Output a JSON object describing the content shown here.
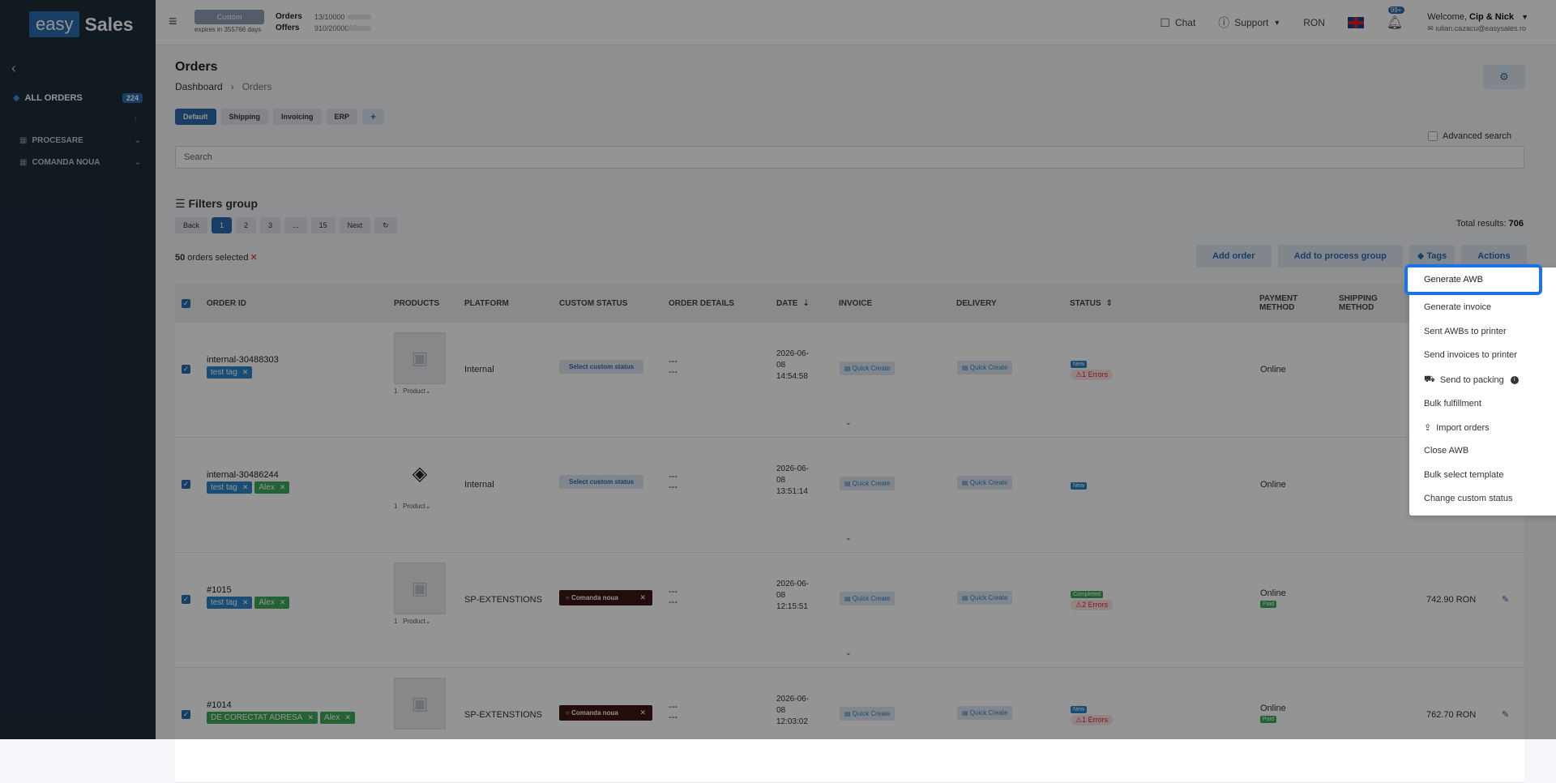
{
  "sidebar": {
    "logo_easy": "easy",
    "logo_sales": "Sales",
    "all_orders": "ALL ORDERS",
    "all_orders_count": "224",
    "groups": [
      "PROCESARE",
      "COMANDA NOUA"
    ]
  },
  "topbar": {
    "plan": "Custom",
    "expires": "expires in 355766 days",
    "orders_label": "Orders",
    "orders_value": "13/10000",
    "offers_label": "Offers",
    "offers_value": "910/2000000",
    "chat": "Chat",
    "support": "Support",
    "currency": "RON",
    "notif_badge": "99+",
    "welcome_prefix": "Welcome, ",
    "user_name": "Cip & Nick",
    "email": "iulian.cazacu@easysales.ro"
  },
  "page": {
    "title": "Orders",
    "breadcrumb_home": "Dashboard",
    "breadcrumb_current": "Orders",
    "view_tabs": [
      "Default",
      "Shipping",
      "Invoicing",
      "ERP"
    ],
    "advanced_search": "Advanced search",
    "search_placeholder": "Search",
    "filters_title": "Filters group",
    "pager": [
      "Back",
      "1",
      "2",
      "3",
      "...",
      "15",
      "Next"
    ],
    "total_label": "Total results: ",
    "total_value": "706",
    "selected_count": "50",
    "selected_text": " orders selected",
    "bulk_buttons": [
      "Add order",
      "Add to process group",
      "Tags",
      "Actions"
    ]
  },
  "table": {
    "headers": {
      "order_id": "ORDER ID",
      "products": "PRODUCTS",
      "platform": "PLATFORM",
      "custom_status": "CUSTOM STATUS",
      "order_details": "ORDER DETAILS",
      "date": "DATE",
      "invoice": "INVOICE",
      "delivery": "DELIVERY",
      "status": "STATUS",
      "payment_method_1": "PAYMENT",
      "payment_method_2": "METHOD",
      "shipping_method_1": "SHIPPING",
      "shipping_method_2": "METHOD"
    },
    "quick_create": "Quick Create",
    "product_label": "Product",
    "select_custom_status": "Select custom status",
    "rows": [
      {
        "id": "internal-30488303",
        "tags": [
          "test tag"
        ],
        "green_tags": [],
        "qty": "1",
        "platform": "Internal",
        "custom": "",
        "d1": "2026-06-",
        "d2": "08",
        "d3": "14:54:58",
        "status": "New",
        "errors": "1 Errors",
        "payment": "Online",
        "paid": "",
        "total": ""
      },
      {
        "id": "internal-30486244",
        "tags": [
          "test tag"
        ],
        "green_tags": [
          "Alex"
        ],
        "qty": "1",
        "platform": "Internal",
        "custom": "",
        "d1": "2026-06-",
        "d2": "08",
        "d3": "13:51:14",
        "status": "New",
        "errors": "",
        "payment": "Online",
        "paid": "",
        "total": ""
      },
      {
        "id": "#1015",
        "tags": [
          "test tag"
        ],
        "green_tags": [
          "Alex"
        ],
        "qty": "1",
        "platform": "SP-EXTENSTIONS",
        "custom": "Comanda noua",
        "d1": "2026-06-",
        "d2": "08",
        "d3": "12:15:51",
        "status": "Completed",
        "errors": "2 Errors",
        "payment": "Online",
        "paid": "Paid",
        "total": "742.90 RON"
      },
      {
        "id": "#1014",
        "tags": [],
        "green_tags": [
          "DE CORECTAT ADRESA",
          "Alex"
        ],
        "qty": "1",
        "platform": "SP-EXTENSTIONS",
        "custom": "Comanda noua",
        "d1": "2026-06-",
        "d2": "08",
        "d3": "12:03:02",
        "status": "New",
        "errors": "1 Errors",
        "payment": "Online",
        "paid": "Paid",
        "total": "762.70 RON"
      }
    ],
    "dashes": "---"
  },
  "actions_menu": {
    "items": [
      "Generate AWB",
      "Generate invoice",
      "Sent AWBs to printer",
      "Send invoices to printer",
      "Send to packing",
      "Bulk fulfillment",
      "Import orders",
      "Close AWB",
      "Bulk select template",
      "Change custom status"
    ],
    "highlighted": "Generate AWB"
  },
  "colors": {
    "primary": "#2b6cb0",
    "sidebar": "#1e2b3a",
    "highlight": "#1a73e8"
  }
}
